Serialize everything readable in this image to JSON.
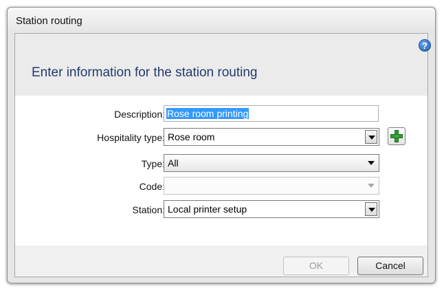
{
  "window": {
    "title": "Station routing"
  },
  "header": {
    "heading": "Enter information for the station routing",
    "help_icon": "?"
  },
  "form": {
    "description": {
      "label": "Description:",
      "value": "Rose room printing"
    },
    "hospitality_type": {
      "label": "Hospitality type:",
      "value": "Rose room"
    },
    "type": {
      "label": "Type:",
      "value": "All"
    },
    "code": {
      "label": "Code:",
      "value": ""
    },
    "station": {
      "label": "Station:",
      "value": "Local printer setup"
    }
  },
  "buttons": {
    "ok": "OK",
    "cancel": "Cancel"
  },
  "colors": {
    "heading": "#23396e",
    "selection": "#3399ff",
    "add_icon": "#2f9a2f"
  }
}
